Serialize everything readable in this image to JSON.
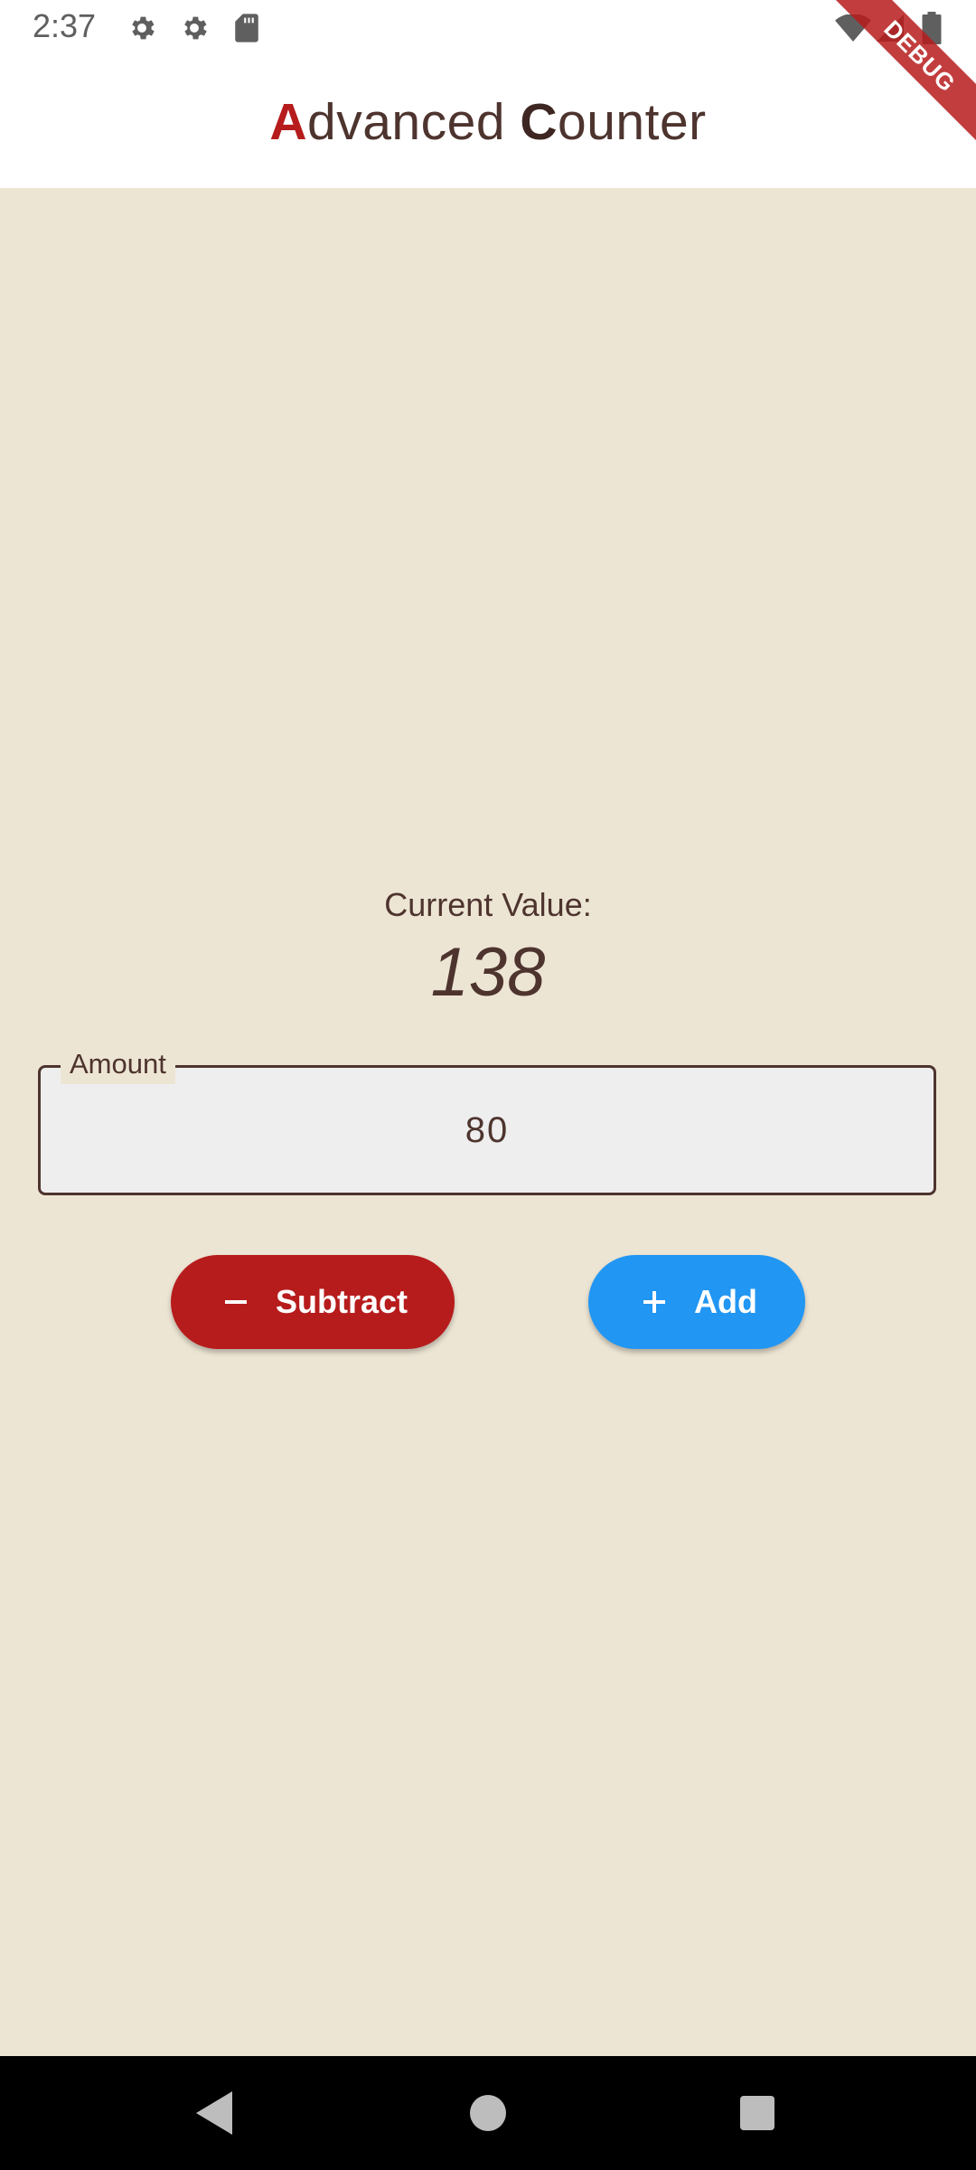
{
  "status_bar": {
    "time": "2:37",
    "icons_left": [
      "gear-icon",
      "gear-icon",
      "sd-card-icon"
    ],
    "icons_right": [
      "wifi-icon",
      "signal-icon",
      "battery-icon"
    ]
  },
  "app_bar": {
    "title_first_initial": "A",
    "title_first_rest": "dvanced ",
    "title_second_initial": "C",
    "title_second_rest": "ounter"
  },
  "debug_banner": {
    "label": "DEBUG"
  },
  "counter": {
    "label": "Current Value:",
    "value": "138"
  },
  "amount_field": {
    "label": "Amount",
    "value": "80"
  },
  "buttons": {
    "subtract_label": "Subtract",
    "add_label": "Add"
  },
  "nav_bar": {
    "items": [
      "back-icon",
      "home-icon",
      "recents-icon"
    ]
  },
  "colors": {
    "background": "#EDE5D4",
    "accent_red": "#B71C1C",
    "accent_blue": "#2196F3",
    "text_brown": "#4E342E"
  }
}
